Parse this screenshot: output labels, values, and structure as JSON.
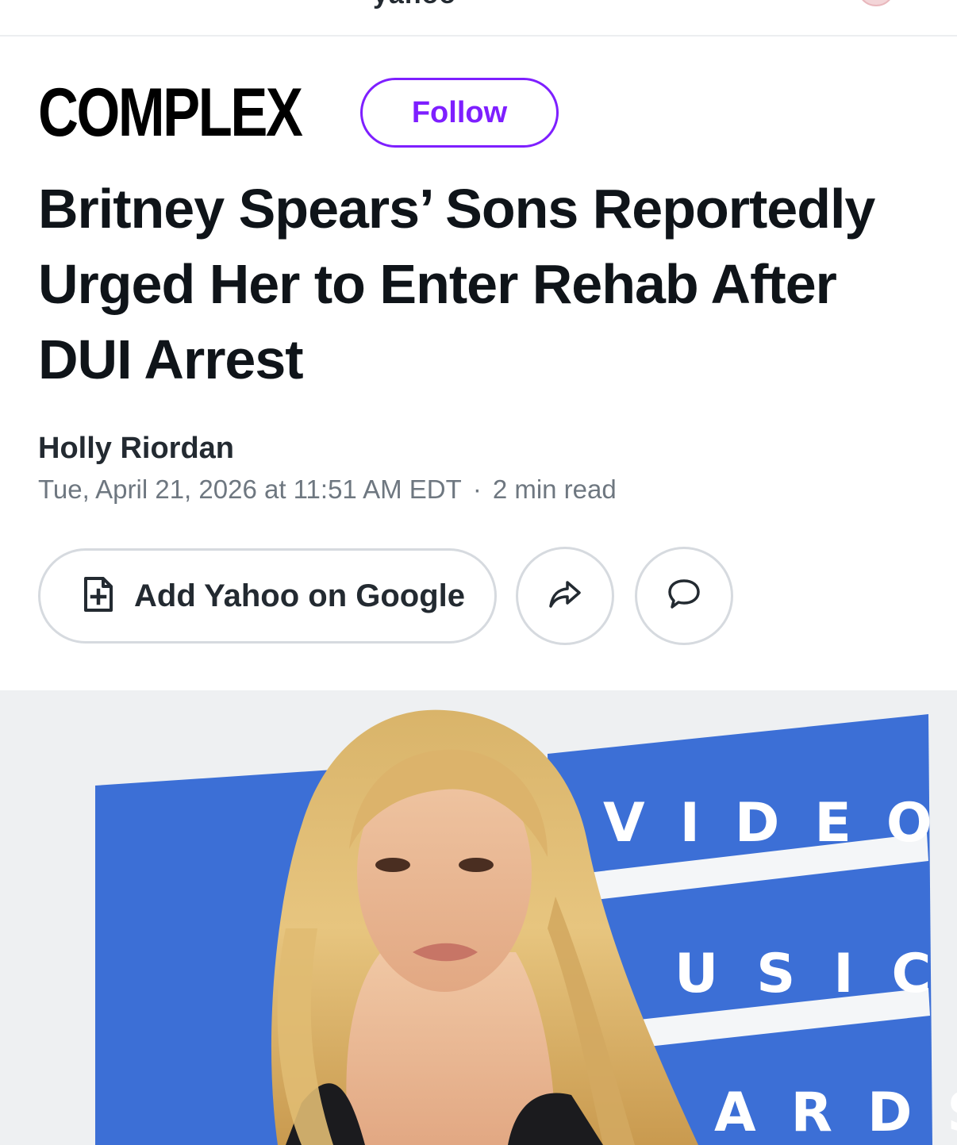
{
  "topbar": {
    "cut_title": "yahoo",
    "avatar_icon": "avatar-icon"
  },
  "publisher": {
    "name": "COMPLEX",
    "follow_label": "Follow",
    "accent": "#7e1fff"
  },
  "article": {
    "headline": "Britney Spears’ Sons Reportedly Urged Her to Enter Rehab After DUI Arrest",
    "author": "Holly Riordan",
    "date": "Tue, April 21, 2026 at 11:51 AM EDT",
    "separator": "·",
    "read_time": "2 min read"
  },
  "actions": {
    "add_label": "Add Yahoo on Google",
    "add_icon": "document-plus-icon",
    "share_icon": "share-arrow-icon",
    "comment_icon": "comment-bubble-icon"
  },
  "hero": {
    "backdrop_letters_row1": "VIDEO",
    "backdrop_letters_row2": "USIC",
    "backdrop_letters_row3": "ARDS",
    "backdrop_color": "#3c6fd6"
  }
}
